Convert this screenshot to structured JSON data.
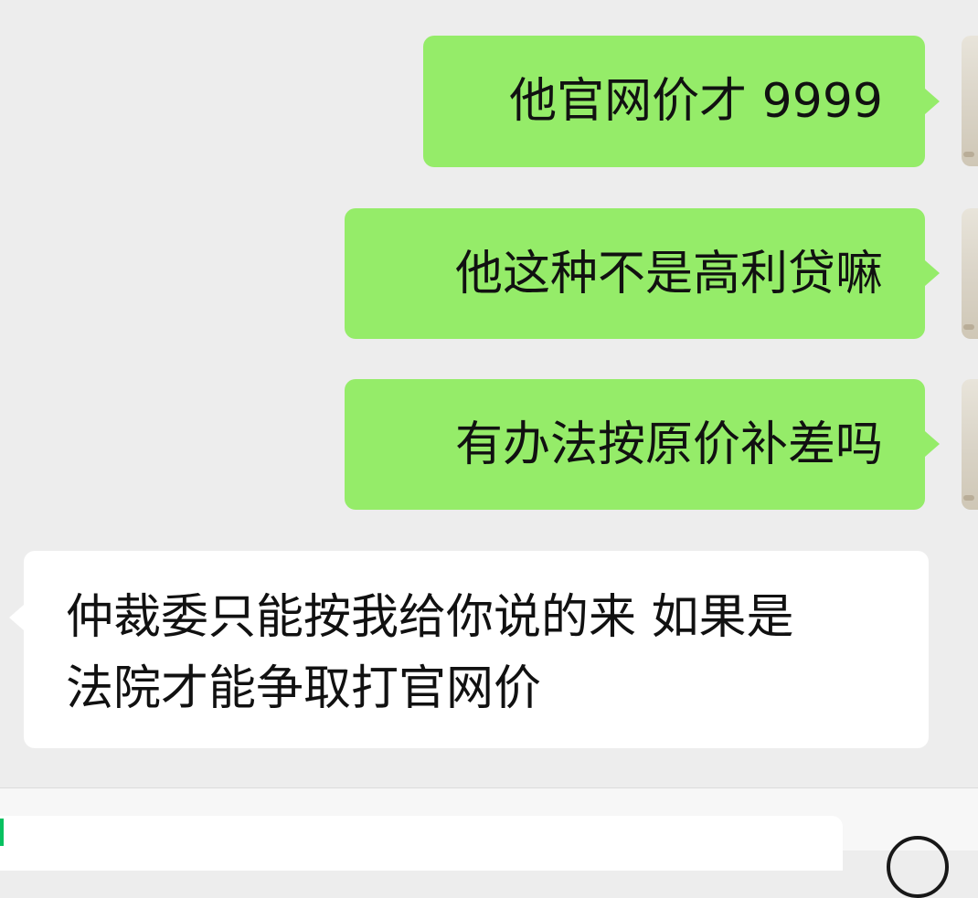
{
  "chat": {
    "messages": [
      {
        "direction": "outgoing",
        "text": "他官网价才 9999"
      },
      {
        "direction": "outgoing",
        "text": "他这种不是高利贷嘛"
      },
      {
        "direction": "outgoing",
        "text": "有办法按原价补差吗"
      },
      {
        "direction": "incoming",
        "line1": "仲裁委只能按我给你说的来 如果是",
        "line2": "法院才能争取打官网价"
      }
    ]
  },
  "colors": {
    "background": "#ededed",
    "outgoing_bubble": "#95ec69",
    "incoming_bubble": "#ffffff",
    "text": "#111111",
    "caret": "#07c160"
  },
  "input": {
    "value": ""
  },
  "icons": {
    "avatar": "user-avatar-image",
    "voice": "voice-input-icon"
  }
}
